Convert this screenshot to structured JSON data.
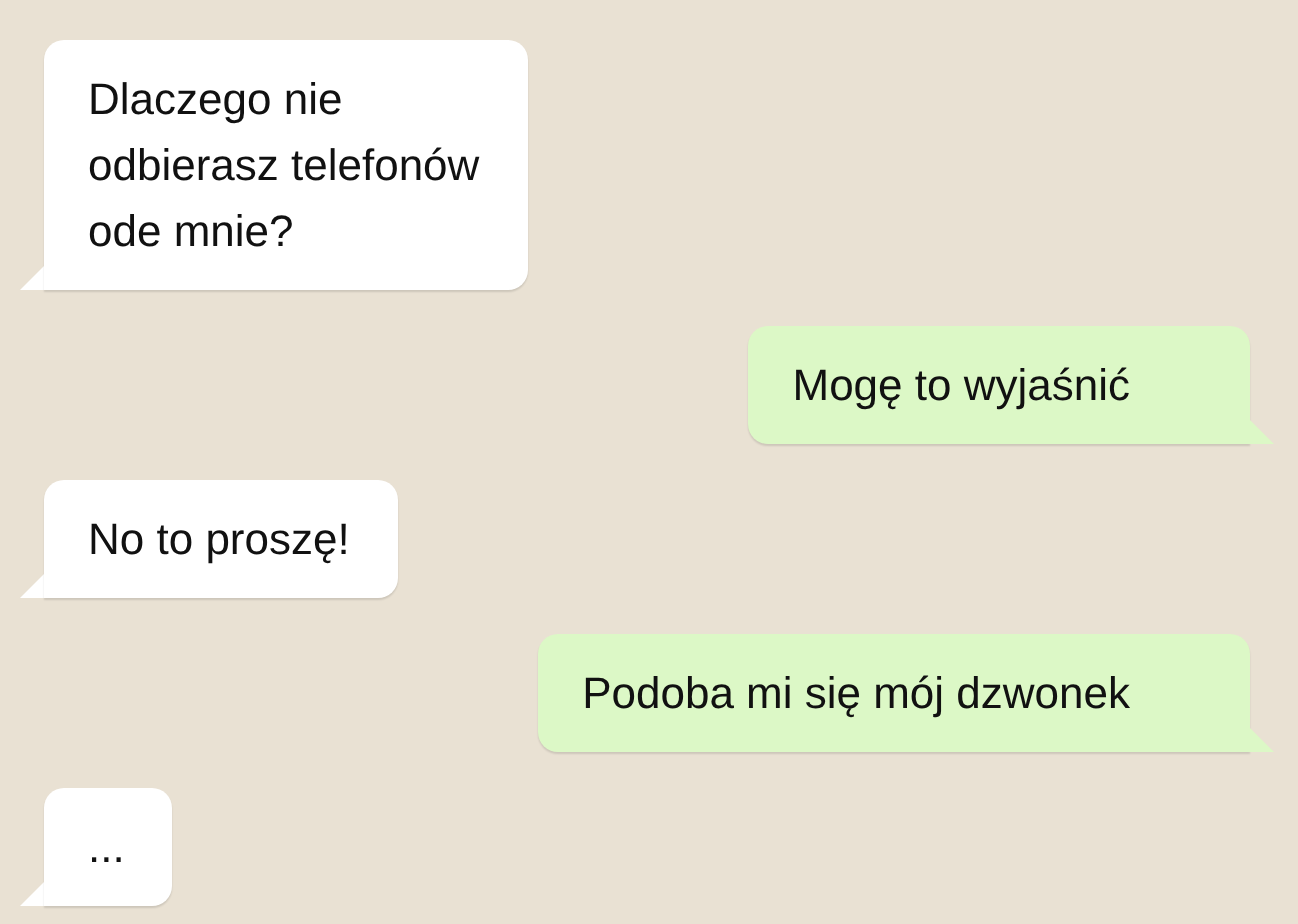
{
  "messages": [
    {
      "kind": "incoming",
      "text": "Dlaczego nie\nodbierasz telefonów\node mnie?"
    },
    {
      "kind": "outgoing",
      "text": "Mogę to wyjaśnić"
    },
    {
      "kind": "incoming",
      "text": "No to proszę!"
    },
    {
      "kind": "outgoing",
      "text": "Podoba mi się mój dzwonek"
    },
    {
      "kind": "incoming",
      "text": "..."
    }
  ]
}
